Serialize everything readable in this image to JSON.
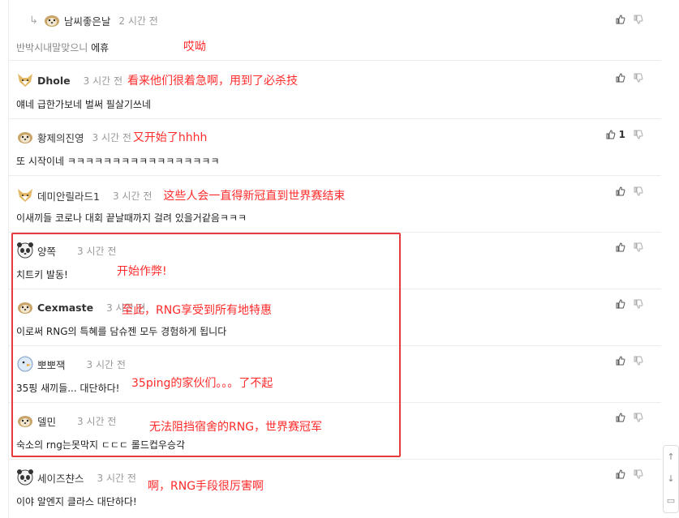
{
  "comments": [
    {
      "author": "남씨좋은날",
      "time": "2 시간 전",
      "body_muted": "반박시내말맞으니 ",
      "body": "에휴",
      "note": "哎呦",
      "likes": ""
    },
    {
      "author": "Dhole",
      "time": "3 시간 전",
      "body": "얘네 급한가보네 벌써 필살기쓰네",
      "note": "看来他们很着急啊，用到了必杀技",
      "likes": ""
    },
    {
      "author": "황제의진영",
      "time": "3 시간 전",
      "body": "또 시작이네 ㅋㅋㅋㅋㅋㅋㅋㅋㅋㅋㅋㅋㅋㅋㅋㅋㅋ",
      "note": "又开始了hhhh",
      "likes": "1"
    },
    {
      "author": "데미안릴라드1",
      "time": "3 시간 전",
      "body": "이새끼들 코로나 대회 끝날때까지 걸려 있을거같음ㅋㅋㅋ",
      "note": "这些人会一直得新冠直到世界赛结束",
      "likes": ""
    },
    {
      "author": "양쪽",
      "time": "3 시간 전",
      "body": "치트키 발동!",
      "note": "开始作弊!",
      "likes": ""
    },
    {
      "author": "Cexmaste",
      "time": "3 시간 전",
      "body": "이로써 RNG의 특혜를 담슈젠 모두 경험하게 됩니다",
      "note": "至此，RNG享受到所有地特惠",
      "likes": ""
    },
    {
      "author": "뽀뽀잭",
      "time": "3 시간 전",
      "body": "35핑 새끼들... 대단하다!",
      "note": "35ping的家伙们。。。了不起",
      "likes": ""
    },
    {
      "author": "델민",
      "time": "3 시간 전",
      "body": "숙소의 rng는못막지 ㄷㄷㄷ 롤드컵우승각",
      "note": "无法阻挡宿舍的RNG，世界赛冠军",
      "likes": ""
    },
    {
      "author": "세이즈챤스",
      "time": "3 시간 전",
      "body": "이야 알엔지 클라스 대단하다!",
      "note": "啊，RNG手段很厉害啊",
      "likes": ""
    }
  ],
  "scroll": {
    "up": "↑",
    "down": "↓",
    "chat": "▭"
  },
  "colors": {
    "annotation": "#ff2b2b",
    "box": "#e83a3a"
  }
}
